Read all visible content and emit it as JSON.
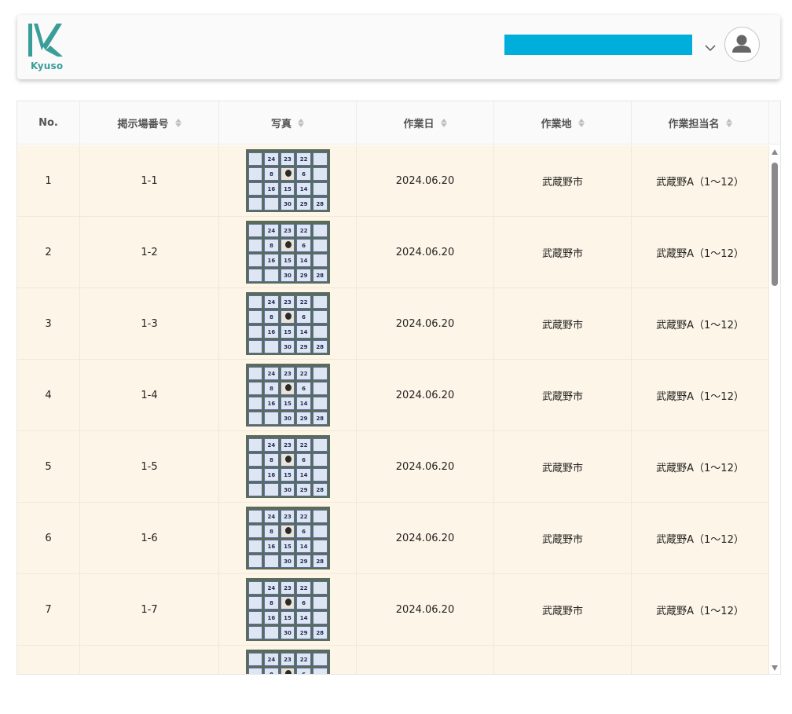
{
  "header": {
    "logo_text": "Kyuso",
    "brand_color": "#3a9e98",
    "user_bar_color": "#00aedb",
    "icons": {
      "dropdown": "chevron-down-icon",
      "avatar": "user-avatar-icon"
    }
  },
  "table": {
    "columns": [
      "No.",
      "掲示場番号",
      "写真",
      "作業日",
      "作業地",
      "作業担当名"
    ],
    "rows": [
      {
        "no": "1",
        "board": "1-1",
        "date": "2024.06.20",
        "place": "武蔵野市",
        "assignee": "武蔵野A（1〜12）"
      },
      {
        "no": "2",
        "board": "1-2",
        "date": "2024.06.20",
        "place": "武蔵野市",
        "assignee": "武蔵野A（1〜12）"
      },
      {
        "no": "3",
        "board": "1-3",
        "date": "2024.06.20",
        "place": "武蔵野市",
        "assignee": "武蔵野A（1〜12）"
      },
      {
        "no": "4",
        "board": "1-4",
        "date": "2024.06.20",
        "place": "武蔵野市",
        "assignee": "武蔵野A（1〜12）"
      },
      {
        "no": "5",
        "board": "1-5",
        "date": "2024.06.20",
        "place": "武蔵野市",
        "assignee": "武蔵野A（1〜12）"
      },
      {
        "no": "6",
        "board": "1-6",
        "date": "2024.06.20",
        "place": "武蔵野市",
        "assignee": "武蔵野A（1〜12）"
      },
      {
        "no": "7",
        "board": "1-7",
        "date": "2024.06.20",
        "place": "武蔵野市",
        "assignee": "武蔵野A（1〜12）"
      },
      {
        "no": "",
        "board": "",
        "date": "",
        "place": "",
        "assignee": ""
      }
    ],
    "photo_cells": [
      "",
      "24",
      "23",
      "22",
      "",
      "",
      "8",
      "",
      "6",
      "",
      "",
      "16",
      "15",
      "14",
      "",
      "",
      "",
      "30",
      "29",
      "28"
    ],
    "row_bg": "#fdf5e7"
  }
}
